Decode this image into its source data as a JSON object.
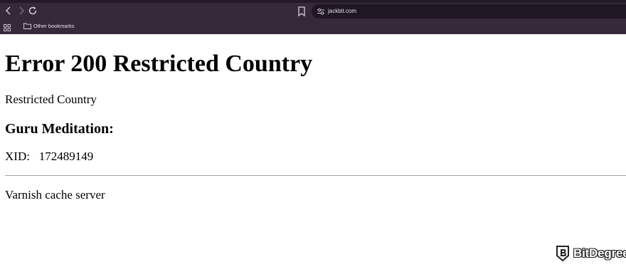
{
  "browser": {
    "url": "jackbit.com",
    "bookmarks_bar": {
      "folder_label": "Other bookmarks"
    },
    "icons": {
      "back": "chevron-left-icon",
      "forward": "chevron-right-icon",
      "reload": "reload-icon",
      "bookmark": "bookmark-icon",
      "site_info": "tune-icon",
      "apps": "apps-grid-icon",
      "folder": "folder-icon"
    },
    "colors": {
      "toolbar": "#35293a",
      "omnibox": "#1f1724"
    }
  },
  "page": {
    "heading": "Error 200 Restricted Country",
    "message": "Restricted Country",
    "subheading": "Guru Meditation:",
    "xid_text": "XID:   172489149",
    "footer": "Varnish cache server"
  },
  "watermark": {
    "text": "BitDegree"
  }
}
